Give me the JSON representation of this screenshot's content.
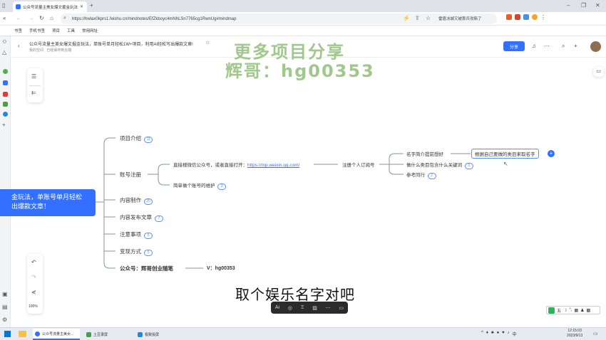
{
  "browser": {
    "tab_title": "公众号流量主美女爆文掘金玩法",
    "url": "https://hwlax0kprs1.feishu.cn/mindnotes/EfZkboyc4mNhLSn7765cg1RwnUg#mindmap",
    "notice": "雷霆冰城又被那兵攻陷了",
    "bookmarks": [
      "书签",
      "手机书签",
      "项目",
      "工具",
      "常用网址"
    ]
  },
  "doc": {
    "title": "公众号流量主美女爆文掘金玩法，单账号单月轻松1W+项目，利用AI轻松写出爆款文章!",
    "subtitle_left": "我的空间",
    "subtitle_right": "已经保存到云端",
    "share_label": "分享"
  },
  "watermark": {
    "line1": "更多项目分享",
    "line2": "辉哥：hg00353"
  },
  "mindmap": {
    "root": [
      "金玩法，单账号单月轻松",
      "出爆款文章！"
    ],
    "branches": [
      {
        "label": "项目介绍",
        "badge": "11"
      },
      {
        "label": "账号注册",
        "badge": ""
      },
      {
        "label": "内容制作",
        "badge": "25"
      },
      {
        "label": "内容发布文章",
        "badge": "7"
      },
      {
        "label": "注意事项",
        "badge": "6"
      },
      {
        "label": "变现方式",
        "badge": "5"
      },
      {
        "label": "公众号：辉哥创业随笔",
        "badge": ""
      }
    ],
    "reg_children": [
      {
        "label": "直接搜微信公众号，或者直接打开：",
        "link": "https://mp.weixin.qq.com/"
      },
      {
        "label": "简单做个账号的维护",
        "badge": "3"
      }
    ],
    "subscribe": "注册个人订阅号",
    "name_children": [
      {
        "label": "名字简介提前想好"
      },
      {
        "label": "做什么类目包含什么关键词",
        "badge": "3"
      },
      {
        "label": "参考同行",
        "badge": "2"
      }
    ],
    "editing_node": "根据自己要做的类目来取名字",
    "contact": "V：hg00353"
  },
  "zoom": "100%",
  "caption": "取个娱乐名字对吧",
  "taskbar": {
    "apps": [
      "公众号流量主美女...",
      "土豆录屏",
      "极致投屏"
    ],
    "time": "12:15:03",
    "date": "2023/9/13",
    "ime": "中"
  },
  "colors": {
    "accent": "#3370ff",
    "line": "#8a93a0"
  }
}
